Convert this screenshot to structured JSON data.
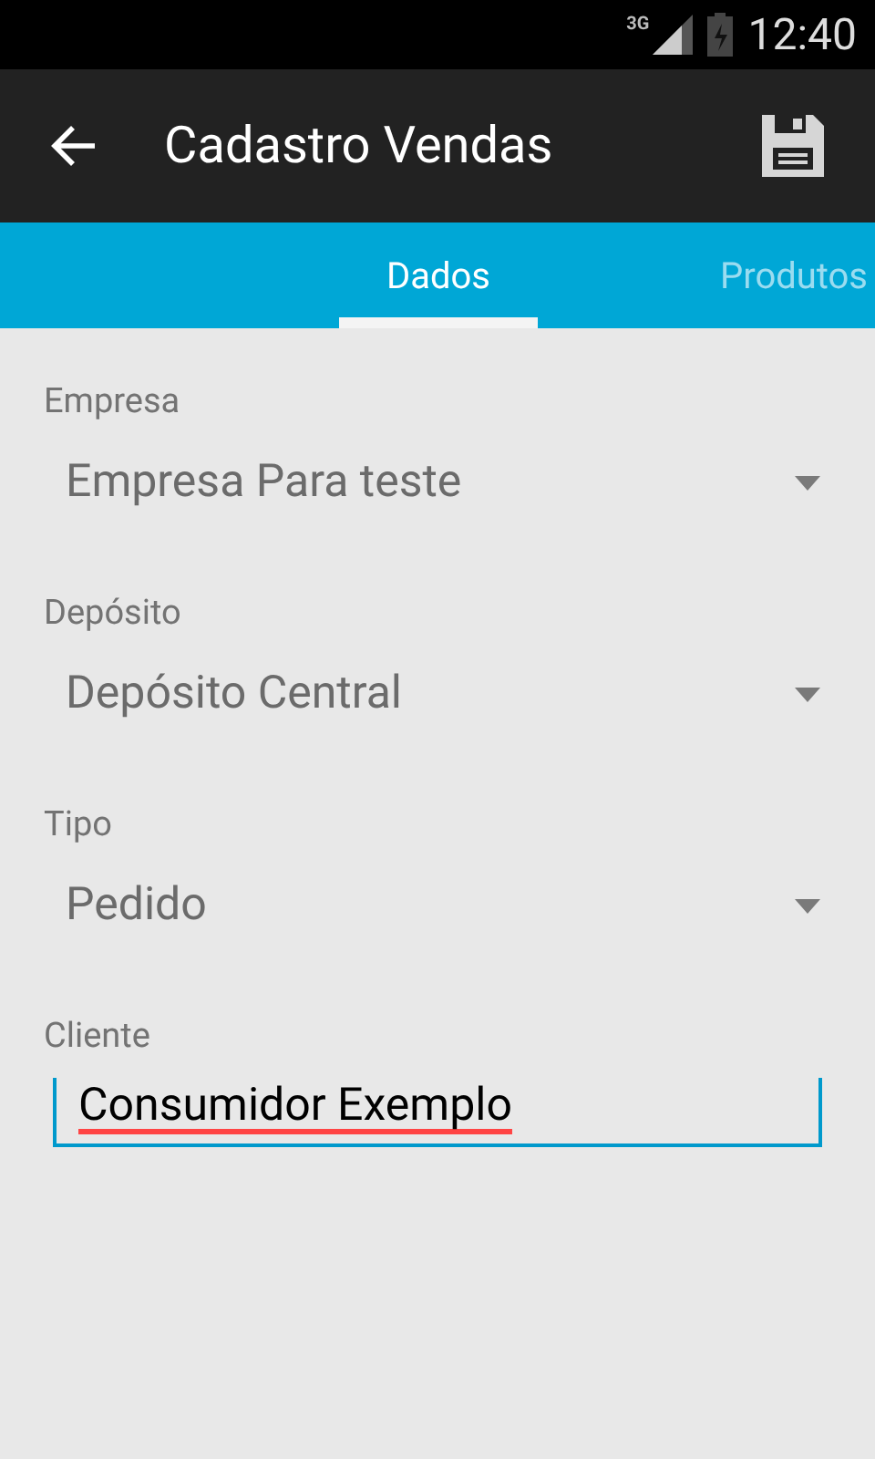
{
  "status_bar": {
    "network": "3G",
    "time": "12:40"
  },
  "app_bar": {
    "title": "Cadastro Vendas"
  },
  "tabs": [
    {
      "label": "Dados",
      "selected": true
    },
    {
      "label": "Produtos",
      "selected": false
    }
  ],
  "fields": [
    {
      "kind": "spinner",
      "label": "Empresa",
      "value": "Empresa Para teste"
    },
    {
      "kind": "spinner",
      "label": "Depósito",
      "value": "Depósito Central"
    },
    {
      "kind": "spinner",
      "label": "Tipo",
      "value": "Pedido"
    },
    {
      "kind": "text",
      "label": "Cliente",
      "value": "Consumidor Exemplo"
    }
  ]
}
